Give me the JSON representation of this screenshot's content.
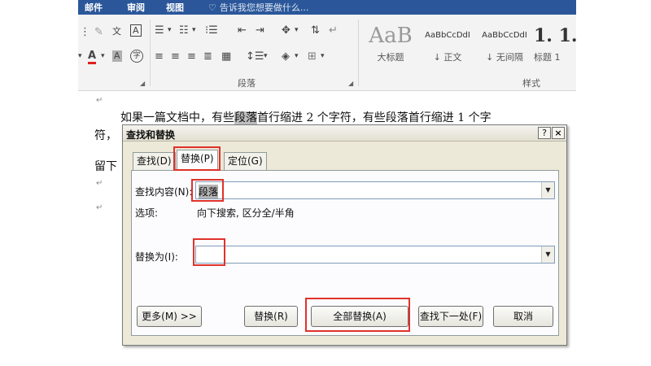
{
  "menubar": {
    "items": [
      "邮件",
      "审阅",
      "视图"
    ],
    "tell_me": "告诉我您想要做什么..."
  },
  "ribbon": {
    "font_group": {
      "icons": [
        "clear-format-icon",
        "phonetic-guide-icon",
        "char-border-icon",
        "font-color-icon",
        "highlight-icon",
        "char-shading-icon",
        "enclose-char-icon"
      ],
      "font_color_glyph": "A",
      "wen_glyph": "文",
      "box_glyph": "A",
      "shade_glyph": "A",
      "circle_glyph": "字"
    },
    "paragraph_group": {
      "label": "段落"
    },
    "styles_group": {
      "label": "样式",
      "styles": [
        {
          "sample": "AaB",
          "name": "大标题"
        },
        {
          "sample": "AaBbCcDdI",
          "name": "↓ 正文"
        },
        {
          "sample": "AaBbCcDdI",
          "name": "↓ 无间隔"
        },
        {
          "sample": "1. 1.",
          "name": "标题 1"
        }
      ]
    }
  },
  "document": {
    "line1_before": "如果一篇文档中，有些",
    "line1_highlight": "段落",
    "line1_after": "首行缩进 2 个字符，有些段落首行缩进 1 个字",
    "line2": "符，",
    "line3": "留下",
    "para_mark": "↵"
  },
  "dialog": {
    "title": "查找和替换",
    "help_btn": "?",
    "close_btn": "×",
    "tabs": [
      "查找(D)",
      "替换(P)",
      "定位(G)"
    ],
    "find_label": "查找内容(N):",
    "find_value": "段落",
    "options_label": "选项:",
    "options_value": "向下搜索, 区分全/半角",
    "replace_label": "替换为(I):",
    "replace_value": "",
    "buttons": {
      "more": "更多(M) >>",
      "replace": "替换(R)",
      "replace_all": "全部替换(A)",
      "find_next": "查找下一处(F)",
      "cancel": "取消"
    }
  },
  "colors": {
    "title_bar": "#2b579a",
    "highlight_box": "#e0322b",
    "dialog_bg": "#ece9d8",
    "font_color_underline": "#e02020"
  }
}
